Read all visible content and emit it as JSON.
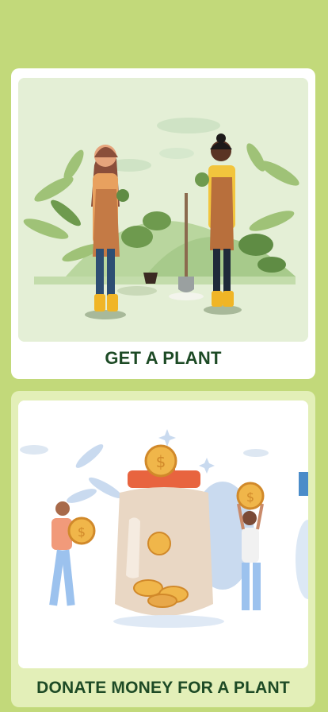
{
  "cards": {
    "get_plant": {
      "label": "GET A PLANT",
      "illustration": "gardeners-planting-illustration"
    },
    "donate": {
      "label": "DONATE MONEY FOR A PLANT",
      "illustration": "donation-jar-coins-illustration"
    }
  },
  "colors": {
    "background": "#c2d97a",
    "label_text": "#1d4a25",
    "card_plant_bg": "#ffffff",
    "card_donate_bg": "#e3efb8"
  }
}
